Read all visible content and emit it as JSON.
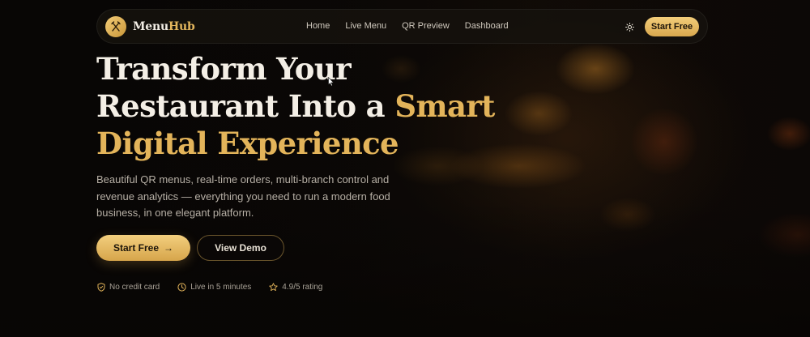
{
  "colors": {
    "accent_gold": "#e3b45a",
    "background": "#0b0806",
    "text_primary": "#f4efe6",
    "text_muted": "#b6afa5"
  },
  "navbar": {
    "brand": {
      "logo_icon": "fork-knife-icon",
      "name_part1": "Menu",
      "name_part2": "Hub"
    },
    "links": [
      "Home",
      "Live Menu",
      "QR Preview",
      "Dashboard"
    ],
    "theme_toggle_icon": "sun-icon",
    "cta_label": "Start Free"
  },
  "hero": {
    "title_line1": "Transform Your",
    "title_line2_plain": "Restaurant Into a ",
    "title_line2_gold": "Smart",
    "title_line3_gold": "Digital Experience",
    "subtitle": "Beautiful QR menus, real-time orders, multi-branch control and revenue analytics — everything you need to run a modern food business, in one elegant platform.",
    "primary_button": {
      "label": "Start Free",
      "icon": "arrow-right-icon",
      "arrow": "→"
    },
    "secondary_button": {
      "label": "View Demo"
    },
    "features": [
      {
        "icon": "shield-check-icon",
        "label": "No credit card"
      },
      {
        "icon": "clock-icon",
        "label": "Live in 5 minutes"
      },
      {
        "icon": "star-icon",
        "label": "4.9/5 rating"
      }
    ]
  }
}
